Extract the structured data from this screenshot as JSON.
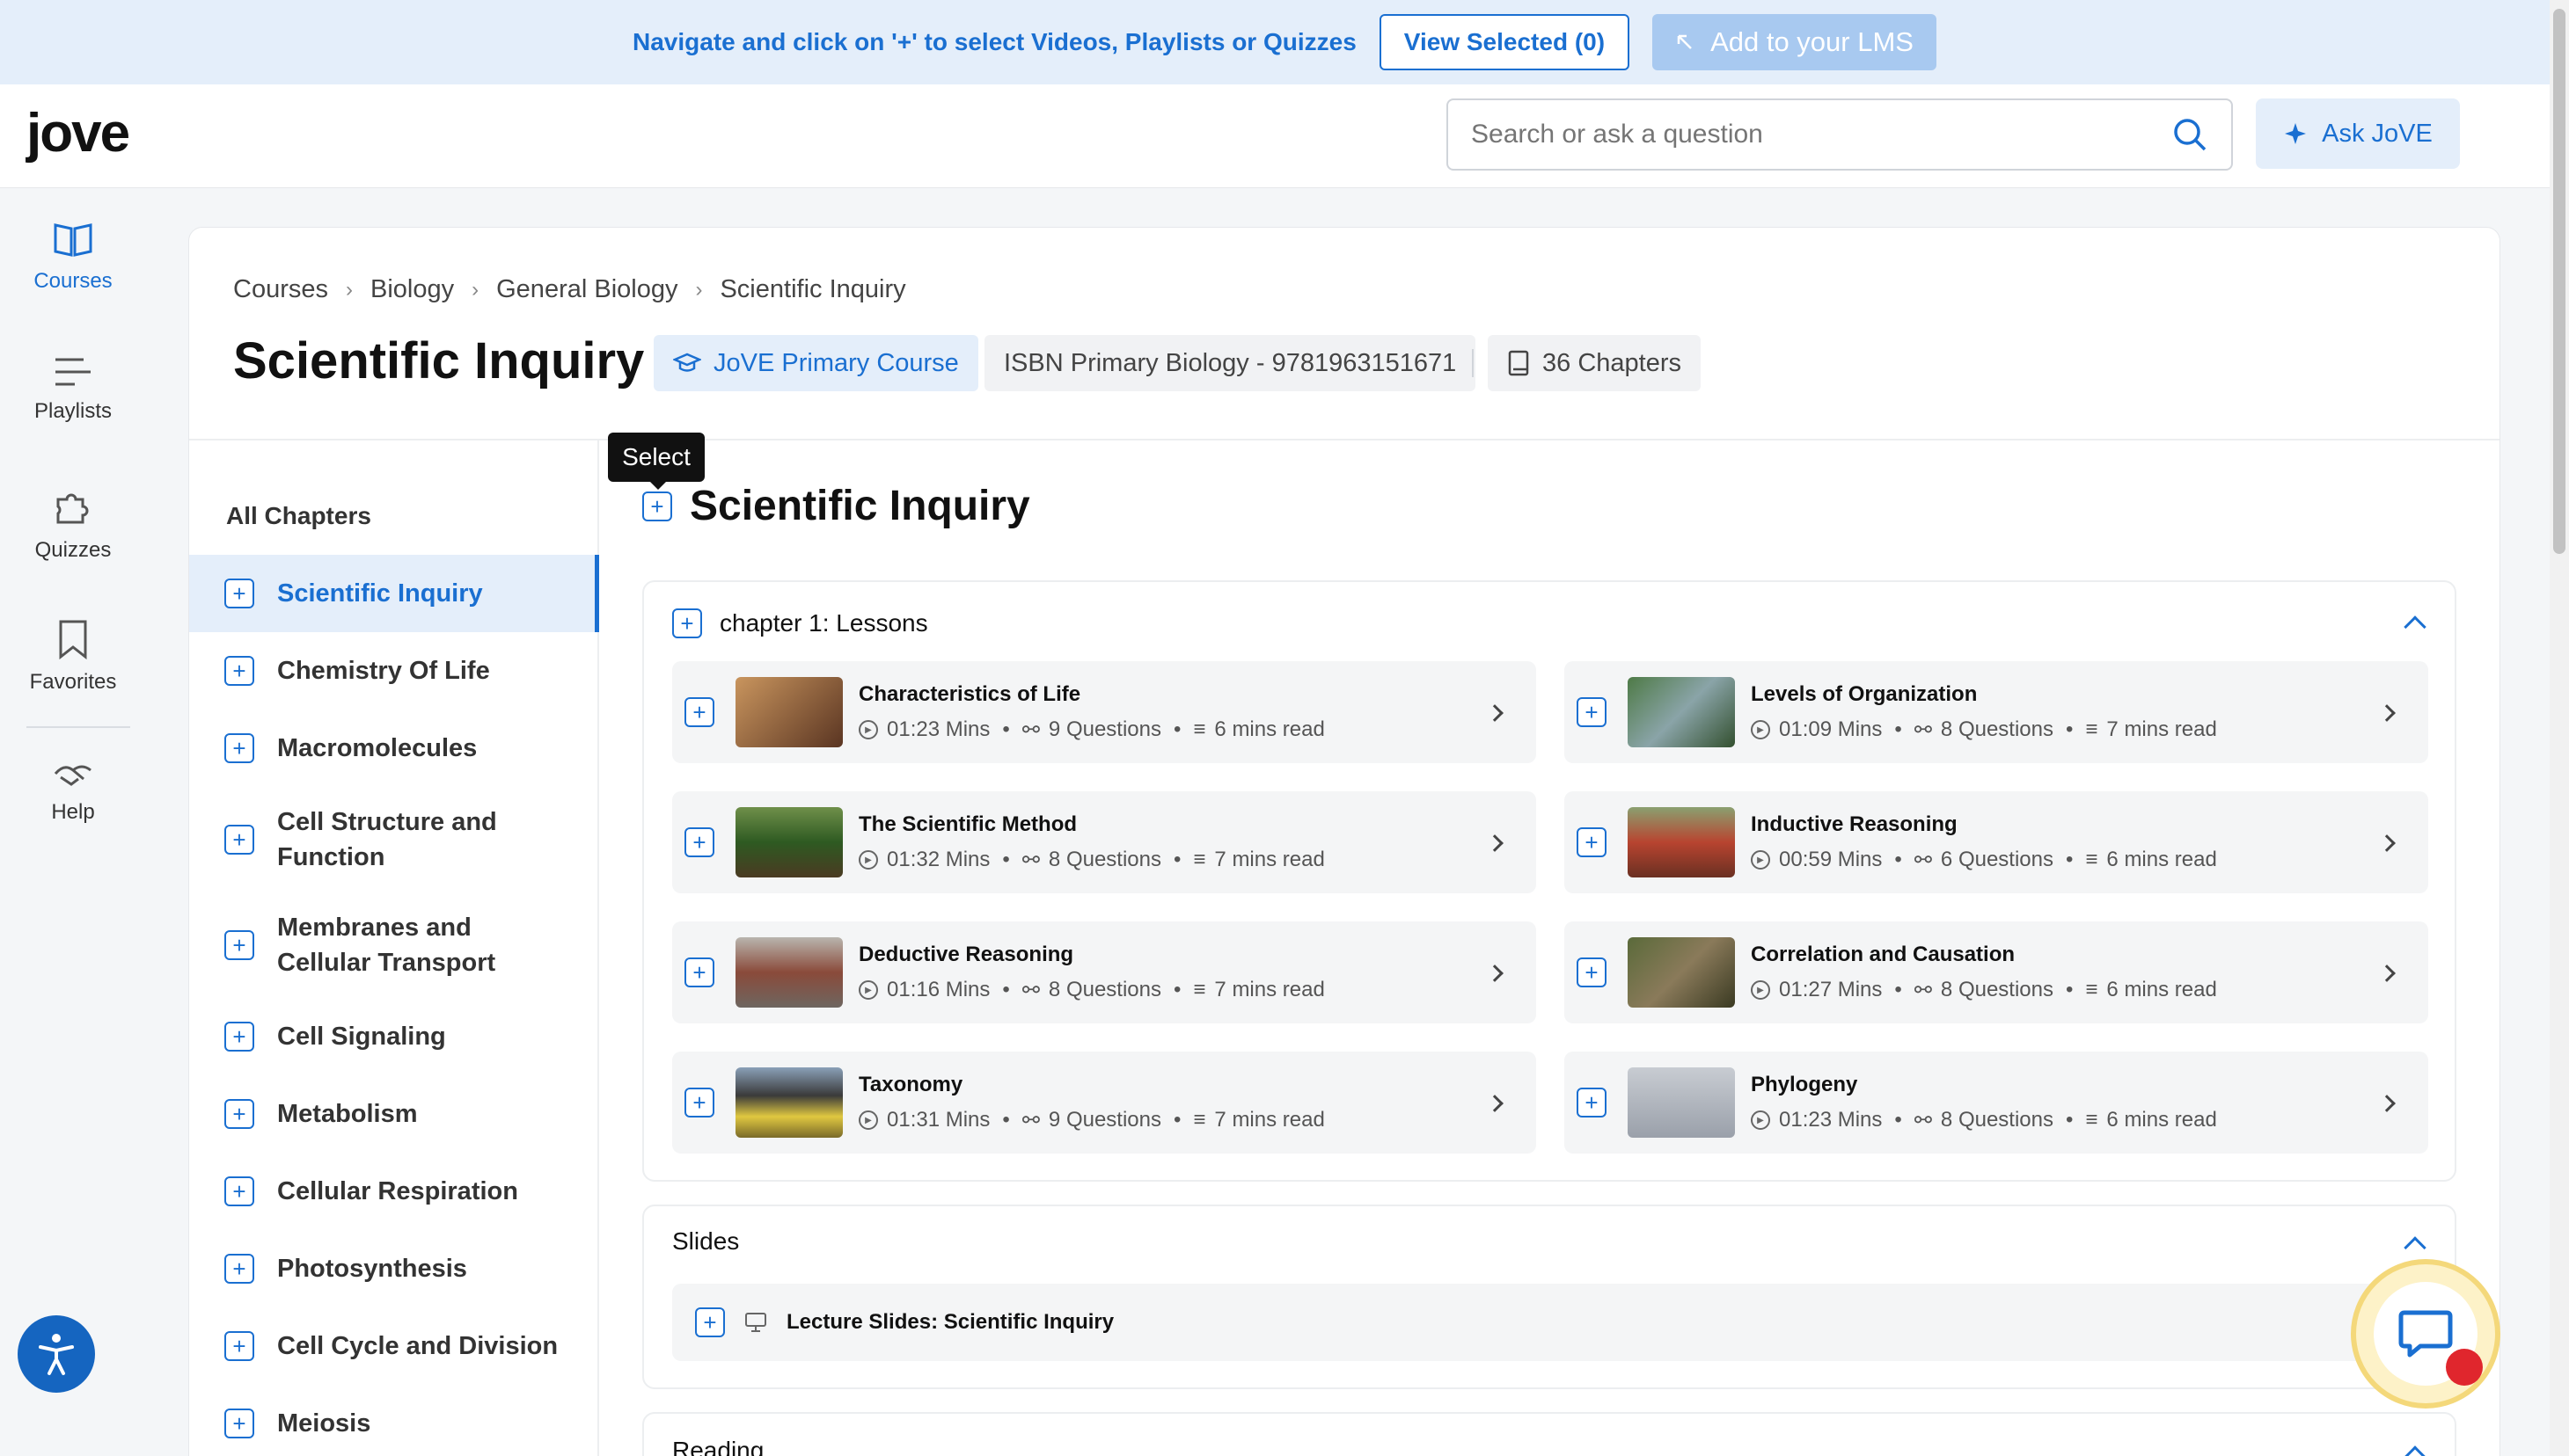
{
  "banner": {
    "text": "Navigate and click on '+' to select Videos, Playlists or Quizzes",
    "view_selected": "View Selected (0)",
    "add_lms": "Add to your LMS"
  },
  "header": {
    "logo": "jove",
    "search_placeholder": "Search or ask a question",
    "ask_label": "Ask JoVE"
  },
  "leftnav": {
    "items": [
      {
        "label": "Courses",
        "icon": "book-open-icon",
        "active": true
      },
      {
        "label": "Playlists",
        "icon": "list-icon"
      },
      {
        "label": "Quizzes",
        "icon": "puzzle-icon"
      },
      {
        "label": "Favorites",
        "icon": "bookmark-icon"
      },
      {
        "label": "Help",
        "icon": "handshake-icon"
      }
    ]
  },
  "breadcrumb": [
    "Courses",
    "Biology",
    "General Biology",
    "Scientific Inquiry"
  ],
  "page": {
    "title": "Scientific Inquiry",
    "tag_primary": "JoVE Primary Course",
    "tag_isbn": "ISBN Primary Biology - 9781963151671",
    "tag_chapters": "36 Chapters"
  },
  "chapters": {
    "heading": "All Chapters",
    "items": [
      "Scientific Inquiry",
      "Chemistry Of Life",
      "Macromolecules",
      "Cell Structure and Function",
      "Membranes and Cellular Transport",
      "Cell Signaling",
      "Metabolism",
      "Cellular Respiration",
      "Photosynthesis",
      "Cell Cycle and Division",
      "Meiosis"
    ]
  },
  "tooltip": "Select",
  "section": {
    "title": "Scientific Inquiry",
    "lessons_heading": "chapter 1: Lessons",
    "lessons": [
      {
        "title": "Characteristics of Life",
        "duration": "01:23 Mins",
        "questions": "9 Questions",
        "read": "6 mins read",
        "thumb": "#8a5a3a"
      },
      {
        "title": "Levels of Organization",
        "duration": "01:09 Mins",
        "questions": "8 Questions",
        "read": "7 mins read",
        "thumb": "#5c7a55"
      },
      {
        "title": "The Scientific Method",
        "duration": "01:32 Mins",
        "questions": "8 Questions",
        "read": "7 mins read",
        "thumb": "#3f6b2c"
      },
      {
        "title": "Inductive Reasoning",
        "duration": "00:59 Mins",
        "questions": "6 Questions",
        "read": "6 mins read",
        "thumb": "#9b3a2a"
      },
      {
        "title": "Deductive Reasoning",
        "duration": "01:16 Mins",
        "questions": "8 Questions",
        "read": "7 mins read",
        "thumb": "#7a6a5a"
      },
      {
        "title": "Correlation and Causation",
        "duration": "01:27 Mins",
        "questions": "8 Questions",
        "read": "6 mins read",
        "thumb": "#5a5a3c"
      },
      {
        "title": "Taxonomy",
        "duration": "01:31 Mins",
        "questions": "9 Questions",
        "read": "7 mins read",
        "thumb": "#c9b53a"
      },
      {
        "title": "Phylogeny",
        "duration": "01:23 Mins",
        "questions": "8 Questions",
        "read": "6 mins read",
        "thumb": "#a8adb5"
      }
    ],
    "slides_heading": "Slides",
    "slide_item": "Lecture Slides: Scientific Inquiry",
    "reading_heading": "Reading"
  }
}
